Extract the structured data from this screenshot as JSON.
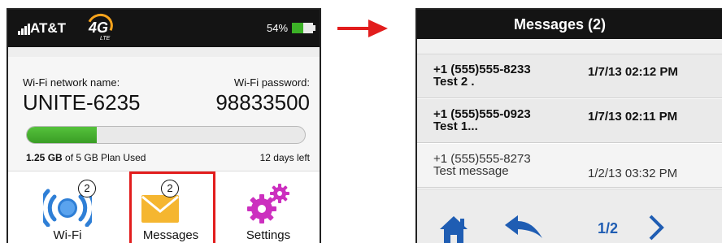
{
  "colors": {
    "status_bar": "#141414",
    "battery": "#3cb227",
    "data_bar": "#4caf34",
    "highlight": "#e21d1d",
    "arrow": "#e21d1d",
    "wifi_icon": "#2f7fd6",
    "messages_icon": "#f5b630",
    "settings_icon": "#cc2fbf",
    "nav_blue": "#1f5db3"
  },
  "device": {
    "status": {
      "carrier": "AT&T",
      "network_badge": "4G",
      "network_badge_sub": "LTE",
      "battery_label": "54%",
      "battery_level": 0.54,
      "signal_icon": "signal-bars-icon"
    },
    "wifi": {
      "name_label": "Wi-Fi network name:",
      "name_value": "UNITE-6235",
      "password_label": "Wi-Fi password:",
      "password_value": "98833500"
    },
    "usage": {
      "used_amount": "1.25 GB",
      "used_text": " of 5 GB Plan Used",
      "fraction_used": 0.25,
      "days_left": "12 days left"
    },
    "dock": [
      {
        "label": "Wi-Fi",
        "icon": "wifi-icon",
        "badge": "2"
      },
      {
        "label": "Messages",
        "icon": "envelope-icon",
        "badge": "2"
      },
      {
        "label": "Settings",
        "icon": "gears-icon",
        "badge": ""
      }
    ]
  },
  "messages_screen": {
    "title": "Messages (2)",
    "messages": [
      {
        "from": "+1 (555)555-8233",
        "text": "Test 2 .",
        "date": "1/7/13 02:12 PM",
        "unread": true
      },
      {
        "from": "+1 (555)555-0923",
        "text": "Test 1...",
        "date": "1/7/13 02:11 PM",
        "unread": true
      },
      {
        "from": "+1 (555)555-8273",
        "text": "Test message",
        "date": "1/2/13 03:32 PM",
        "unread": false
      }
    ],
    "footer": {
      "home_icon": "home-icon",
      "back_icon": "back-arrow-icon",
      "page": "1/2",
      "next_icon": "chevron-right-icon"
    }
  }
}
